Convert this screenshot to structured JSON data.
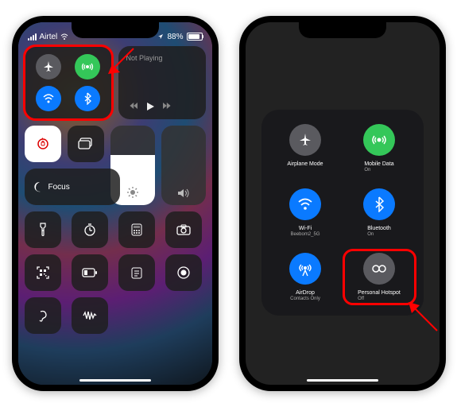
{
  "status": {
    "carrier": "Airtel",
    "battery_pct": "88%"
  },
  "music": {
    "title": "Not Playing"
  },
  "focus": {
    "label": "Focus"
  },
  "icons": {
    "airplane": "airplane",
    "cellular": "cellular",
    "wifi": "wifi",
    "bluetooth": "bluetooth",
    "orientation_lock": "orientation-lock",
    "screen_mirror": "screen-mirror",
    "moon": "moon",
    "sun": "sun",
    "speaker": "speaker",
    "flashlight": "flashlight",
    "timer": "timer",
    "calculator": "calculator",
    "camera": "camera",
    "qr": "qr",
    "low_power": "low-power",
    "notes": "notes",
    "record": "record",
    "hearing": "hearing",
    "voice_memos": "voice-memos"
  },
  "expanded": {
    "airplane": {
      "label": "Airplane Mode",
      "sub": ""
    },
    "cellular": {
      "label": "Mobile Data",
      "sub": "On"
    },
    "wifi": {
      "label": "Wi-Fi",
      "sub": "Beebom2_5G"
    },
    "bluetooth": {
      "label": "Bluetooth",
      "sub": "On"
    },
    "airdrop": {
      "label": "AirDrop",
      "sub": "Contacts Only"
    },
    "hotspot": {
      "label": "Personal Hotspot",
      "sub": "Off"
    }
  }
}
